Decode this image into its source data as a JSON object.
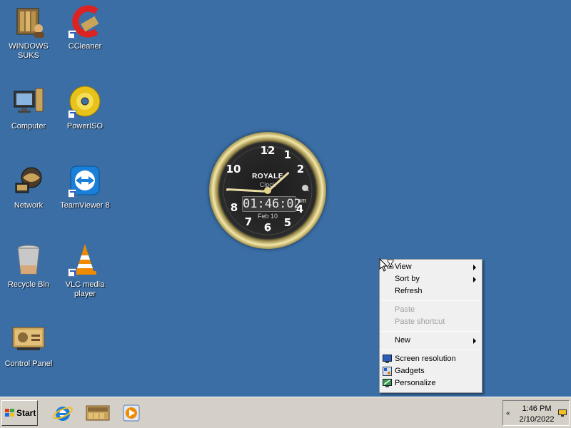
{
  "desktop": {
    "icons": [
      {
        "label": "WINDOWS SUKS",
        "icon": "user-folder-icon"
      },
      {
        "label": "CCleaner",
        "icon": "ccleaner-icon"
      },
      {
        "label": "Computer",
        "icon": "computer-icon"
      },
      {
        "label": "PowerISO",
        "icon": "poweriso-disc-icon"
      },
      {
        "label": "Network",
        "icon": "network-globe-icon"
      },
      {
        "label": "TeamViewer 8",
        "icon": "teamviewer-icon"
      },
      {
        "label": "Recycle Bin",
        "icon": "recycle-bin-icon"
      },
      {
        "label": "VLC media player",
        "icon": "vlc-cone-icon"
      },
      {
        "label": "Control Panel",
        "icon": "control-panel-icon"
      }
    ]
  },
  "clock": {
    "brand": "ROYALE",
    "brand_sub": "Clock",
    "digital_time": "01:46:02",
    "ampm": "pm",
    "date": "Feb 10",
    "numerals": [
      "12",
      "1",
      "2",
      "4",
      "5",
      "6",
      "7",
      "8",
      "10"
    ]
  },
  "context_menu": {
    "view": "View",
    "sort_by": "Sort by",
    "refresh": "Refresh",
    "paste": "Paste",
    "paste_shortcut": "Paste shortcut",
    "new": "New",
    "screen_resolution": "Screen resolution",
    "gadgets": "Gadgets",
    "personalize": "Personalize"
  },
  "taskbar": {
    "start_label": "Start",
    "quick_launch": [
      "internet-explorer-icon",
      "control-panel-icon",
      "media-player-icon"
    ],
    "tray_chevron": "«",
    "time": "1:46 PM",
    "date": "2/10/2022"
  },
  "colors": {
    "desktop_bg": "#3a6ea5",
    "taskbar_bg": "#d4d0c8",
    "menu_bg": "#f0f0f0"
  }
}
